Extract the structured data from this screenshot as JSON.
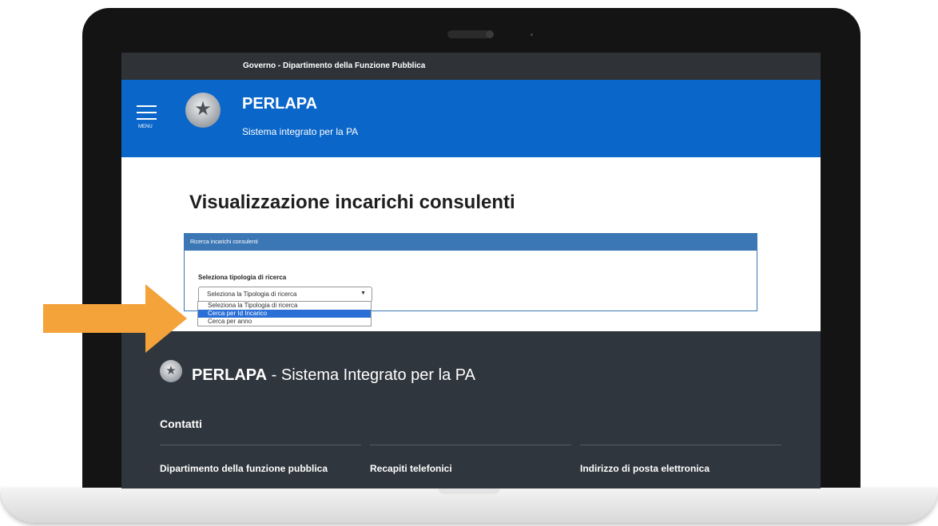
{
  "topbar": {
    "gov_bold": "Governo",
    "gov_rest": " - Dipartimento della Funzione Pubblica"
  },
  "header": {
    "menu_label": "MENU",
    "title": "PERLAPA",
    "subtitle": "Sistema integrato per la PA"
  },
  "page": {
    "title": "Visualizzazione incarichi consulenti"
  },
  "search": {
    "panel_title": "Ricerca incarichi consulenti",
    "field_label": "Seleziona tipologia di ricerca",
    "selected": "Seleziona la Tipologia di ricerca",
    "options": [
      "Seleziona la Tipologia di ricerca",
      "Cerca per Id Incarico",
      "Cerca per anno"
    ],
    "highlighted_index": 1
  },
  "footer": {
    "brand_bold": "PERLAPA",
    "brand_rest": " - Sistema Integrato per la PA",
    "contatti": "Contatti",
    "columns": [
      "Dipartimento della funzione pubblica",
      "Recapiti telefonici",
      "Indirizzo di posta elettronica"
    ]
  },
  "colors": {
    "header_blue": "#0a66c9",
    "topbar": "#2f3338",
    "footer": "#30363d",
    "arrow": "#f4a23a",
    "option_highlight": "#2a6fd6"
  }
}
